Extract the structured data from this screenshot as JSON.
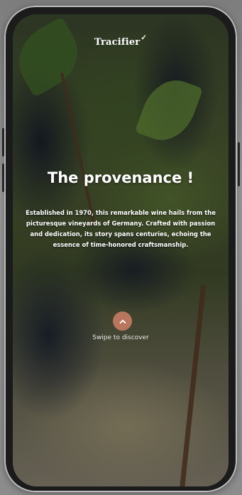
{
  "app": {
    "logo_text": "Tracifier",
    "logo_mark": "✓"
  },
  "hero": {
    "headline": "The provenance !",
    "description": "Established in 1970, this remarkable wine hails from the picturesque vineyards of Germany. Crafted with passion and dedication, its story spans centuries, echoing the essence of time-honored craftsmanship.",
    "swipe_icon": "chevron-up-icon",
    "swipe_label": "Swipe to discover"
  },
  "colors": {
    "accent": "#b8765f",
    "text": "#ffffff"
  }
}
